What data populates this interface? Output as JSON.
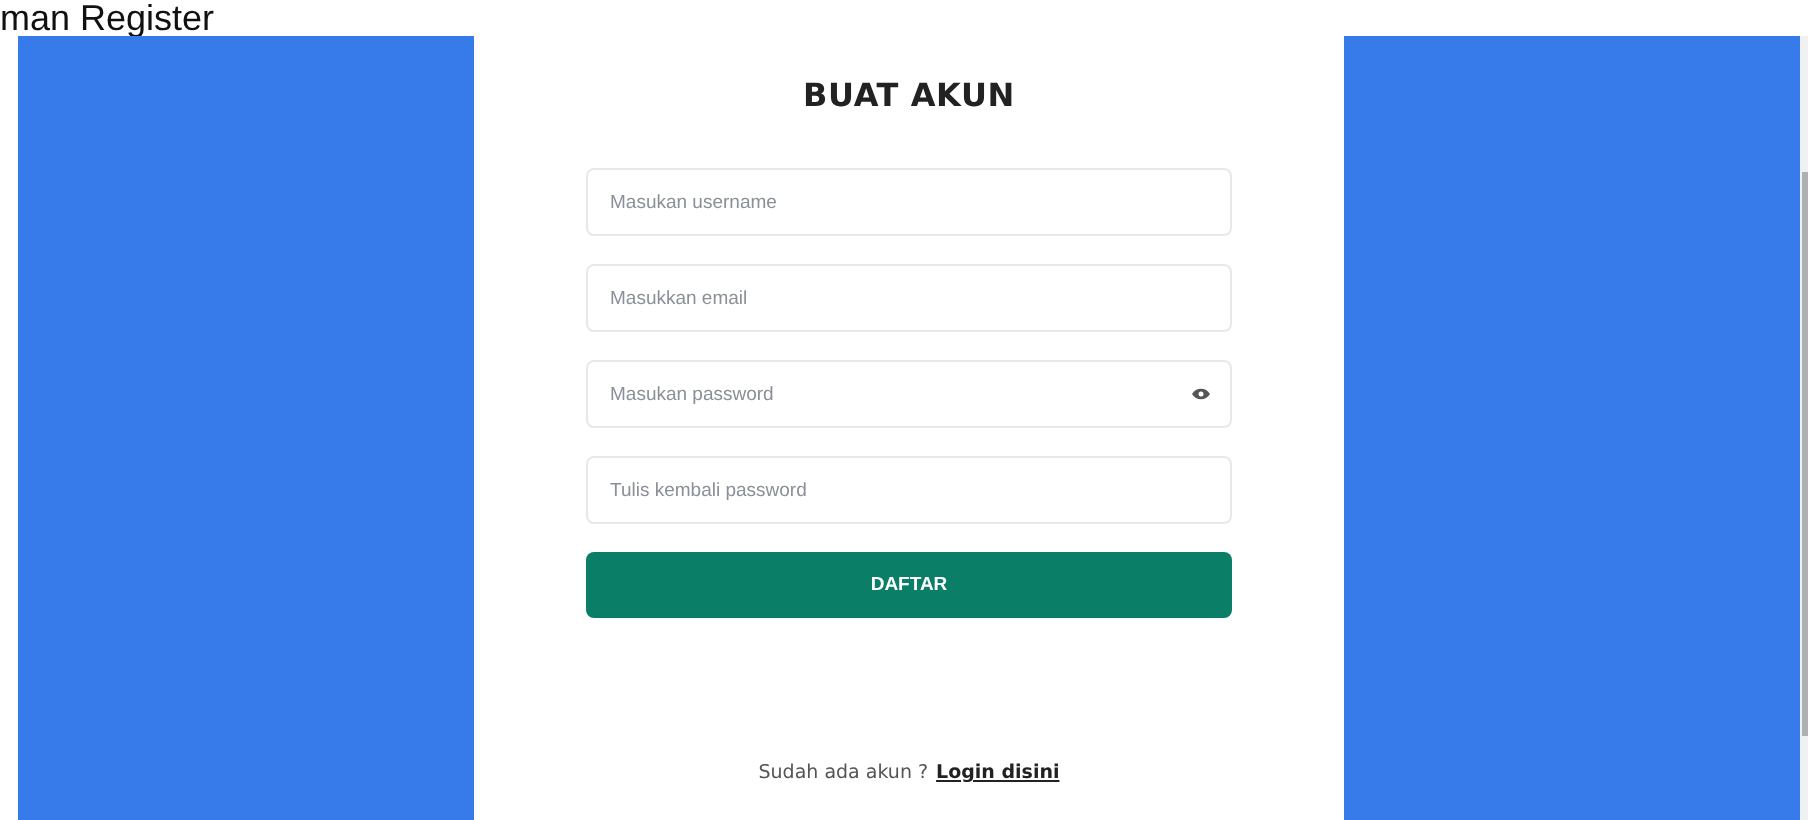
{
  "caption": "man Register",
  "form": {
    "title": "BUAT AKUN",
    "fields": [
      {
        "placeholder": "Masukan username",
        "kind": "text"
      },
      {
        "placeholder": "Masukkan email",
        "kind": "text"
      },
      {
        "placeholder": "Masukan password",
        "kind": "password"
      },
      {
        "placeholder": "Tulis kembali password",
        "kind": "text"
      }
    ],
    "submit": "DAFTAR",
    "footer": {
      "text": "Sudah ada akun ?",
      "link": "Login disini"
    }
  }
}
